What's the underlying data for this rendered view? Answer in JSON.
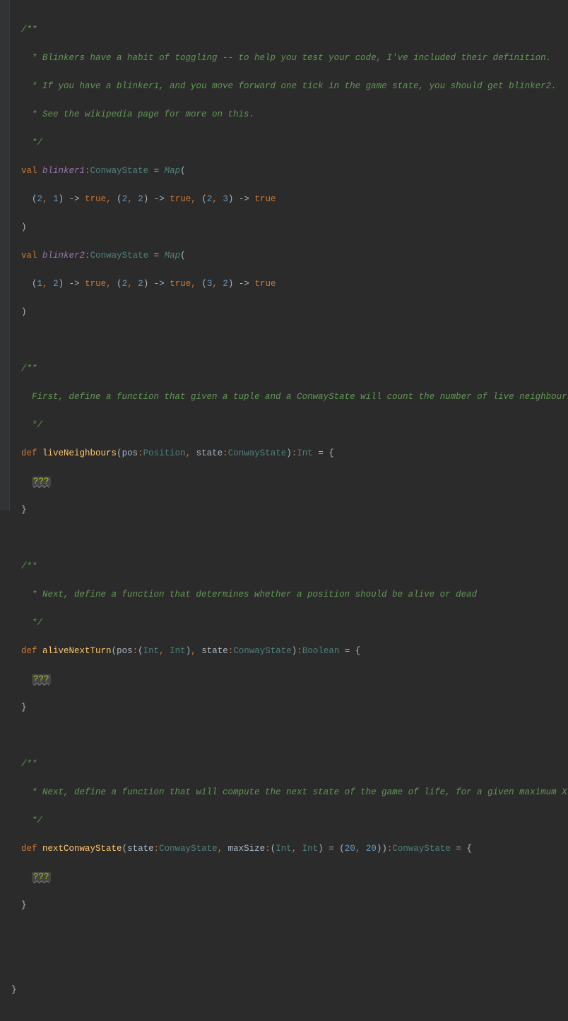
{
  "code": {
    "comment_blinkers": {
      "l1": "/**",
      "l2": "  * Blinkers have a habit of toggling -- to help you test your code, I've included their definition.",
      "l3": "  * If you have a blinker1, and you move forward one tick in the game state, you should get blinker2.",
      "l4": "  * See the wikipedia page for more on this.",
      "l5": "  */"
    },
    "kw_val": "val",
    "kw_def": "def",
    "kw_true": "true",
    "id_blinker1": "blinker1",
    "id_blinker2": "blinker2",
    "t_ConwayState": "ConwayState",
    "t_Position": "Position",
    "t_Int": "Int",
    "t_Boolean": "Boolean",
    "t_Map": "Map",
    "eq": " = ",
    "fn_liveNeighbours": "liveNeighbours",
    "fn_aliveNextTurn": "aliveNextTurn",
    "fn_nextConwayState": "nextConwayState",
    "p_pos": "pos",
    "p_state": "state",
    "p_maxSize": "maxSize",
    "arrow": " -> ",
    "todo": "???",
    "numbers": {
      "n1": "1",
      "n2": "2",
      "n3": "3",
      "n20": "20"
    },
    "comment_liveNeighbours": {
      "l1": "/**",
      "l2": "  First, define a function that given a tuple and a ConwayState will count the number of live neighbours",
      "l3": "  */"
    },
    "comment_aliveNextTurn": {
      "l1": "/**",
      "l2": "  * Next, define a function that determines whether a position should be alive or dead",
      "l3": "  */"
    },
    "comment_nextConwayState": {
      "l1": "/**",
      "l2": "  * Next, define a function that will compute the next state of the game of life, for a given maximum X and Y",
      "l3": "  */"
    }
  }
}
